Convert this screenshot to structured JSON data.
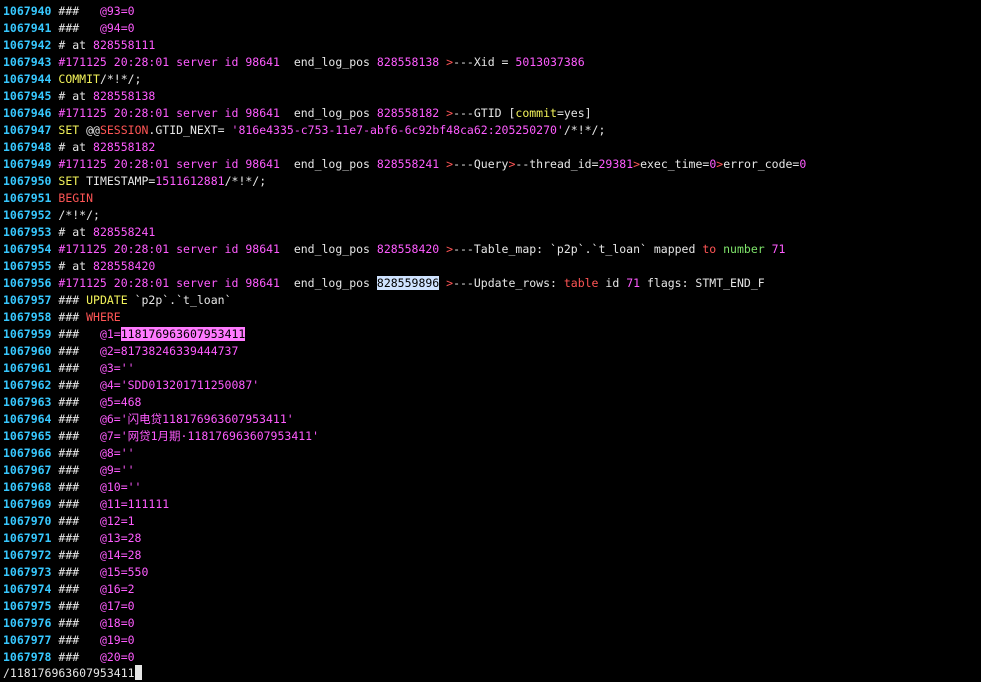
{
  "lines": [
    {
      "n": "1067940",
      "segs": [
        {
          "t": " ###   ",
          "c": "default"
        },
        {
          "t": "@93=0",
          "c": "magenta"
        }
      ]
    },
    {
      "n": "1067941",
      "segs": [
        {
          "t": " ###   ",
          "c": "default"
        },
        {
          "t": "@94=0",
          "c": "magenta"
        }
      ]
    },
    {
      "n": "1067942",
      "segs": [
        {
          "t": " # at ",
          "c": "default"
        },
        {
          "t": "828558111",
          "c": "magenta"
        }
      ]
    },
    {
      "n": "1067943",
      "segs": [
        {
          "t": " #171125 20:28:01 server id ",
          "c": "magenta"
        },
        {
          "t": "98641",
          "c": "magenta"
        },
        {
          "t": "  end_log_pos ",
          "c": "default"
        },
        {
          "t": "828558138",
          "c": "magenta"
        },
        {
          "t": " >",
          "c": "red"
        },
        {
          "t": "---Xid = ",
          "c": "default"
        },
        {
          "t": "5013037386",
          "c": "magenta"
        }
      ]
    },
    {
      "n": "1067944",
      "segs": [
        {
          "t": " COMMIT",
          "c": "yellow"
        },
        {
          "t": "/*!*/;",
          "c": "default"
        }
      ]
    },
    {
      "n": "1067945",
      "segs": [
        {
          "t": " # at ",
          "c": "default"
        },
        {
          "t": "828558138",
          "c": "magenta"
        }
      ]
    },
    {
      "n": "1067946",
      "segs": [
        {
          "t": " #171125 20:28:01 server id ",
          "c": "magenta"
        },
        {
          "t": "98641",
          "c": "magenta"
        },
        {
          "t": "  end_log_pos ",
          "c": "default"
        },
        {
          "t": "828558182",
          "c": "magenta"
        },
        {
          "t": " >",
          "c": "red"
        },
        {
          "t": "---GTID [",
          "c": "default"
        },
        {
          "t": "commit",
          "c": "yellow"
        },
        {
          "t": "=yes]",
          "c": "default"
        }
      ]
    },
    {
      "n": "1067947",
      "segs": [
        {
          "t": " SET ",
          "c": "yellow"
        },
        {
          "t": "@@",
          "c": "default"
        },
        {
          "t": "SESSION",
          "c": "red"
        },
        {
          "t": ".GTID_NEXT= ",
          "c": "default"
        },
        {
          "t": "'816e4335-c753-11e7-abf6-6c92bf48ca62:205250270'",
          "c": "magenta"
        },
        {
          "t": "/*!*/;",
          "c": "default"
        }
      ]
    },
    {
      "n": "1067948",
      "segs": [
        {
          "t": " # at ",
          "c": "default"
        },
        {
          "t": "828558182",
          "c": "magenta"
        }
      ]
    },
    {
      "n": "1067949",
      "segs": [
        {
          "t": " #171125 20:28:01 server id ",
          "c": "magenta"
        },
        {
          "t": "98641",
          "c": "magenta"
        },
        {
          "t": "  end_log_pos ",
          "c": "default"
        },
        {
          "t": "828558241",
          "c": "magenta"
        },
        {
          "t": " >",
          "c": "red"
        },
        {
          "t": "---Query",
          "c": "default"
        },
        {
          "t": ">",
          "c": "red"
        },
        {
          "t": "--thread_id=",
          "c": "default"
        },
        {
          "t": "29381",
          "c": "magenta"
        },
        {
          "t": ">",
          "c": "red"
        },
        {
          "t": "exec_time=",
          "c": "default"
        },
        {
          "t": "0",
          "c": "magenta"
        },
        {
          "t": ">",
          "c": "red"
        },
        {
          "t": "error_code=",
          "c": "default"
        },
        {
          "t": "0",
          "c": "magenta"
        }
      ]
    },
    {
      "n": "1067950",
      "segs": [
        {
          "t": " SET ",
          "c": "yellow"
        },
        {
          "t": "TIMESTAMP=",
          "c": "default"
        },
        {
          "t": "1511612881",
          "c": "magenta"
        },
        {
          "t": "/*!*/;",
          "c": "default"
        }
      ]
    },
    {
      "n": "1067951",
      "segs": [
        {
          "t": " BEGIN",
          "c": "red"
        }
      ]
    },
    {
      "n": "1067952",
      "segs": [
        {
          "t": " /*!*/;",
          "c": "default"
        }
      ]
    },
    {
      "n": "1067953",
      "segs": [
        {
          "t": " # at ",
          "c": "default"
        },
        {
          "t": "828558241",
          "c": "magenta"
        }
      ]
    },
    {
      "n": "1067954",
      "segs": [
        {
          "t": " #171125 20:28:01 server id ",
          "c": "magenta"
        },
        {
          "t": "98641",
          "c": "magenta"
        },
        {
          "t": "  end_log_pos ",
          "c": "default"
        },
        {
          "t": "828558420",
          "c": "magenta"
        },
        {
          "t": " >",
          "c": "red"
        },
        {
          "t": "---Table_map: `p2p`.`t_loan` mapped ",
          "c": "default"
        },
        {
          "t": "to",
          "c": "red"
        },
        {
          "t": " ",
          "c": "default"
        },
        {
          "t": "number",
          "c": "green"
        },
        {
          "t": " 71",
          "c": "magenta"
        }
      ]
    },
    {
      "n": "1067955",
      "segs": [
        {
          "t": " # at ",
          "c": "default"
        },
        {
          "t": "828558420",
          "c": "magenta"
        }
      ]
    },
    {
      "n": "1067956",
      "segs": [
        {
          "t": " #171125 20:28:01 server id ",
          "c": "magenta"
        },
        {
          "t": "98641",
          "c": "magenta"
        },
        {
          "t": "  end_log_pos ",
          "c": "default"
        },
        {
          "t": "828559896",
          "c": "hl-blue"
        },
        {
          "t": " >",
          "c": "red"
        },
        {
          "t": "---Update_rows: ",
          "c": "default"
        },
        {
          "t": "table",
          "c": "red"
        },
        {
          "t": " id ",
          "c": "default"
        },
        {
          "t": "71",
          "c": "magenta"
        },
        {
          "t": " flags: STMT_END_F",
          "c": "default"
        }
      ]
    },
    {
      "n": "1067957",
      "segs": [
        {
          "t": " ### ",
          "c": "default"
        },
        {
          "t": "UPDATE",
          "c": "yellow"
        },
        {
          "t": " `p2p`.`t_loan`",
          "c": "default"
        }
      ]
    },
    {
      "n": "1067958",
      "segs": [
        {
          "t": " ### ",
          "c": "default"
        },
        {
          "t": "WHERE",
          "c": "red"
        }
      ]
    },
    {
      "n": "1067959",
      "segs": [
        {
          "t": " ###   ",
          "c": "default"
        },
        {
          "t": "@1=",
          "c": "magenta"
        },
        {
          "t": "118176963607953411",
          "c": "hl-pink"
        }
      ]
    },
    {
      "n": "1067960",
      "segs": [
        {
          "t": " ###   ",
          "c": "default"
        },
        {
          "t": "@2=81738246339444737",
          "c": "magenta"
        }
      ]
    },
    {
      "n": "1067961",
      "segs": [
        {
          "t": " ###   ",
          "c": "default"
        },
        {
          "t": "@3=''",
          "c": "magenta"
        }
      ]
    },
    {
      "n": "1067962",
      "segs": [
        {
          "t": " ###   ",
          "c": "default"
        },
        {
          "t": "@4='SDD013201711250087'",
          "c": "magenta"
        }
      ]
    },
    {
      "n": "1067963",
      "segs": [
        {
          "t": " ###   ",
          "c": "default"
        },
        {
          "t": "@5=468",
          "c": "magenta"
        }
      ]
    },
    {
      "n": "1067964",
      "segs": [
        {
          "t": " ###   ",
          "c": "default"
        },
        {
          "t": "@6='闪电贷118176963607953411'",
          "c": "magenta"
        }
      ]
    },
    {
      "n": "1067965",
      "segs": [
        {
          "t": " ###   ",
          "c": "default"
        },
        {
          "t": "@7='网贷1月期·118176963607953411'",
          "c": "magenta"
        }
      ]
    },
    {
      "n": "1067966",
      "segs": [
        {
          "t": " ###   ",
          "c": "default"
        },
        {
          "t": "@8=''",
          "c": "magenta"
        }
      ]
    },
    {
      "n": "1067967",
      "segs": [
        {
          "t": " ###   ",
          "c": "default"
        },
        {
          "t": "@9=''",
          "c": "magenta"
        }
      ]
    },
    {
      "n": "1067968",
      "segs": [
        {
          "t": " ###   ",
          "c": "default"
        },
        {
          "t": "@10=''",
          "c": "magenta"
        }
      ]
    },
    {
      "n": "1067969",
      "segs": [
        {
          "t": " ###   ",
          "c": "default"
        },
        {
          "t": "@11=111111",
          "c": "magenta"
        }
      ]
    },
    {
      "n": "1067970",
      "segs": [
        {
          "t": " ###   ",
          "c": "default"
        },
        {
          "t": "@12=1",
          "c": "magenta"
        }
      ]
    },
    {
      "n": "1067971",
      "segs": [
        {
          "t": " ###   ",
          "c": "default"
        },
        {
          "t": "@13=28",
          "c": "magenta"
        }
      ]
    },
    {
      "n": "1067972",
      "segs": [
        {
          "t": " ###   ",
          "c": "default"
        },
        {
          "t": "@14=28",
          "c": "magenta"
        }
      ]
    },
    {
      "n": "1067973",
      "segs": [
        {
          "t": " ###   ",
          "c": "default"
        },
        {
          "t": "@15=550",
          "c": "magenta"
        }
      ]
    },
    {
      "n": "1067974",
      "segs": [
        {
          "t": " ###   ",
          "c": "default"
        },
        {
          "t": "@16=2",
          "c": "magenta"
        }
      ]
    },
    {
      "n": "1067975",
      "segs": [
        {
          "t": " ###   ",
          "c": "default"
        },
        {
          "t": "@17=0",
          "c": "magenta"
        }
      ]
    },
    {
      "n": "1067976",
      "segs": [
        {
          "t": " ###   ",
          "c": "default"
        },
        {
          "t": "@18=0",
          "c": "magenta"
        }
      ]
    },
    {
      "n": "1067977",
      "segs": [
        {
          "t": " ###   ",
          "c": "default"
        },
        {
          "t": "@19=0",
          "c": "magenta"
        }
      ]
    },
    {
      "n": "1067978",
      "segs": [
        {
          "t": " ###   ",
          "c": "default"
        },
        {
          "t": "@20=0",
          "c": "magenta"
        }
      ]
    }
  ],
  "command_line": "/118176963607953411",
  "colors": {
    "background": "#000000",
    "line_number": "#37c8ff",
    "magenta": "#ff5cff",
    "yellow": "#f4f45a",
    "red": "#ff5555",
    "green": "#7ee36a",
    "search_highlight": "#ff7aff",
    "selection_highlight": "#cfe3ff"
  }
}
